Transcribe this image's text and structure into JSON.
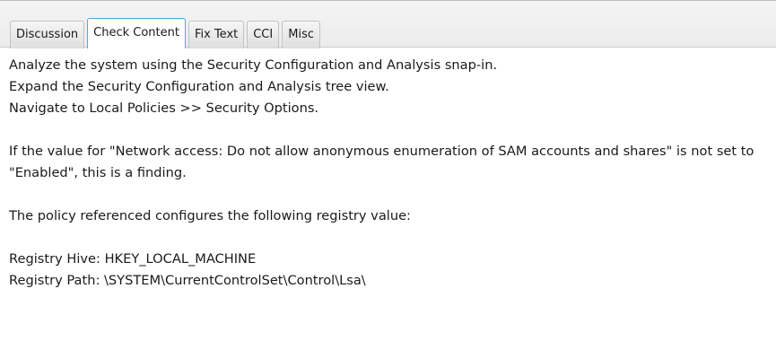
{
  "tabs": [
    {
      "label": "Discussion",
      "active": false
    },
    {
      "label": "Check Content",
      "active": true
    },
    {
      "label": "Fix Text",
      "active": false
    },
    {
      "label": "CCI",
      "active": false
    },
    {
      "label": "Misc",
      "active": false
    }
  ],
  "content": {
    "line1": "Analyze the system using the Security Configuration and Analysis snap-in.",
    "line2": "Expand the Security Configuration and Analysis tree view.",
    "line3": "Navigate to Local Policies >> Security Options.",
    "para2": "If the value for \"Network access: Do not allow anonymous enumeration of SAM accounts and shares\" is not set to \"Enabled\", this is a finding.",
    "para3": "The policy referenced configures the following registry value:",
    "registry_hive": "Registry Hive: HKEY_LOCAL_MACHINE",
    "registry_path": "Registry Path: \\SYSTEM\\CurrentControlSet\\Control\\Lsa\\"
  },
  "colors": {
    "active_tab_border": "#58a6d9",
    "tabstrip_background": "#ececec"
  }
}
